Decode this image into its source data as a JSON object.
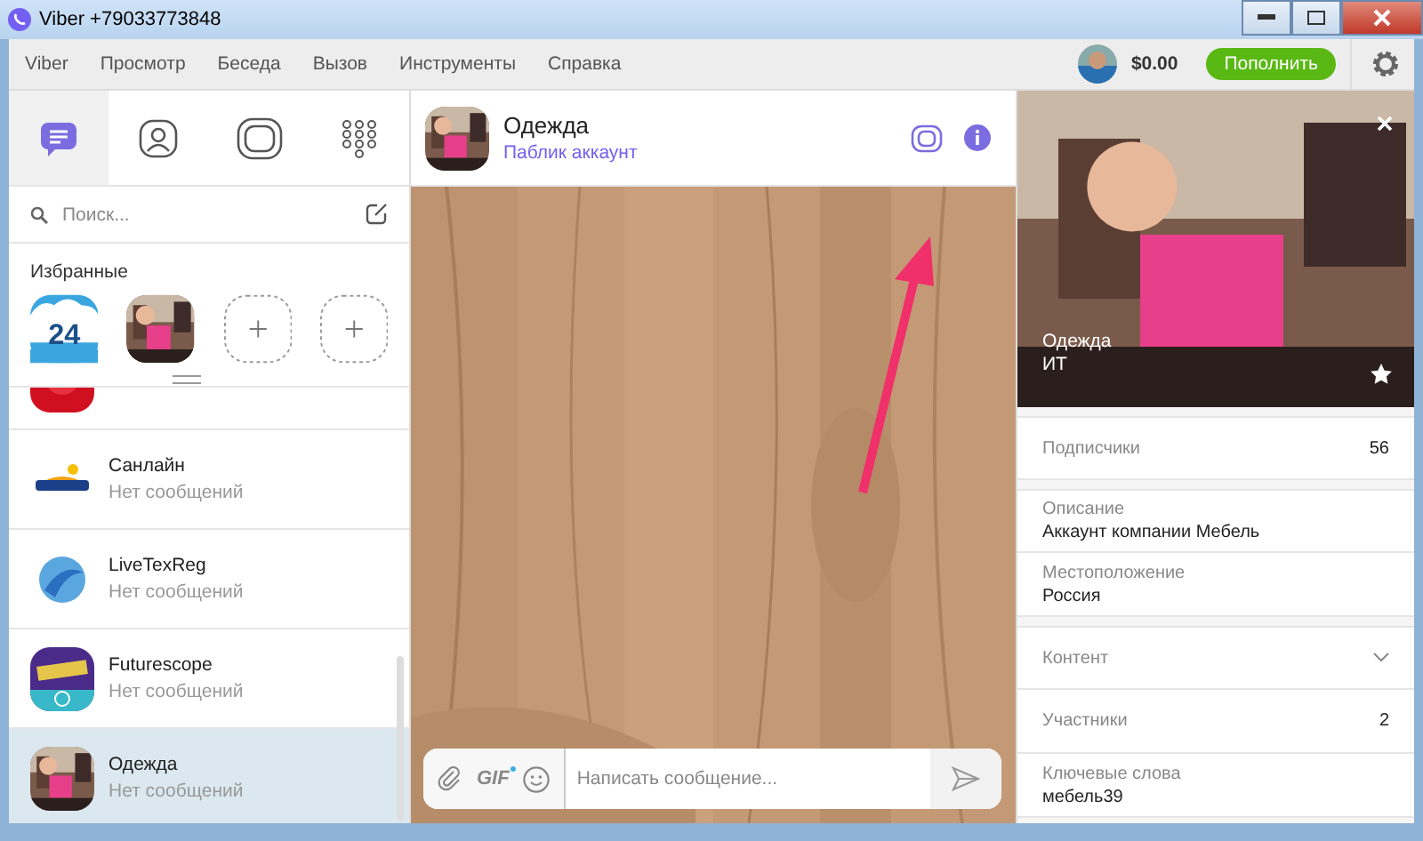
{
  "window": {
    "title": "Viber +79033773848"
  },
  "menu": [
    "Viber",
    "Просмотр",
    "Беседа",
    "Вызов",
    "Инструменты",
    "Справка"
  ],
  "account": {
    "balance": "$0.00",
    "topup_button": "Пополнить"
  },
  "nav_tabs": [
    {
      "kind": "chats",
      "selected": true
    },
    {
      "kind": "contacts",
      "selected": false
    },
    {
      "kind": "public",
      "selected": false
    },
    {
      "kind": "dialpad",
      "selected": false
    }
  ],
  "search": {
    "placeholder": "Поиск..."
  },
  "favorites": {
    "title": "Избранные",
    "items": [
      {
        "kind": "logo",
        "label": "24"
      },
      {
        "kind": "contact"
      },
      {
        "kind": "empty"
      },
      {
        "kind": "empty"
      }
    ]
  },
  "chats": [
    {
      "kind": "cut",
      "selected": false
    },
    {
      "kind": "chat",
      "name": "Санлайн",
      "preview": "Нет сообщений",
      "selected": false
    },
    {
      "kind": "chat",
      "name": "LiveTexReg",
      "preview": "Нет сообщений",
      "selected": false
    },
    {
      "kind": "chat",
      "name": "Futurescope",
      "preview": "Нет сообщений",
      "selected": false
    },
    {
      "kind": "chat",
      "name": "Одежда",
      "preview": "Нет сообщений",
      "selected": true
    }
  ],
  "conversation": {
    "name": "Одежда",
    "subtitle": "Паблик аккаунт"
  },
  "composer": {
    "gif_label": "GIF",
    "placeholder": "Написать сообщение..."
  },
  "info": {
    "name": "Одежда",
    "category": "ИТ",
    "rows": [
      {
        "kind": "value",
        "label": "Подписчики",
        "value": "56",
        "gap_before": true
      },
      {
        "kind": "stacked",
        "label": "Описание",
        "value": "Аккаунт компании Мебель",
        "gap_before": true
      },
      {
        "kind": "stacked",
        "label": "Местоположение",
        "value": "Россия",
        "gap_before": false
      },
      {
        "kind": "expand",
        "label": "Контент",
        "gap_before": true
      },
      {
        "kind": "value",
        "label": "Участники",
        "value": "2",
        "gap_before": false
      },
      {
        "kind": "stacked",
        "label": "Ключевые слова",
        "value": "мебель39",
        "gap_before": false
      }
    ]
  }
}
